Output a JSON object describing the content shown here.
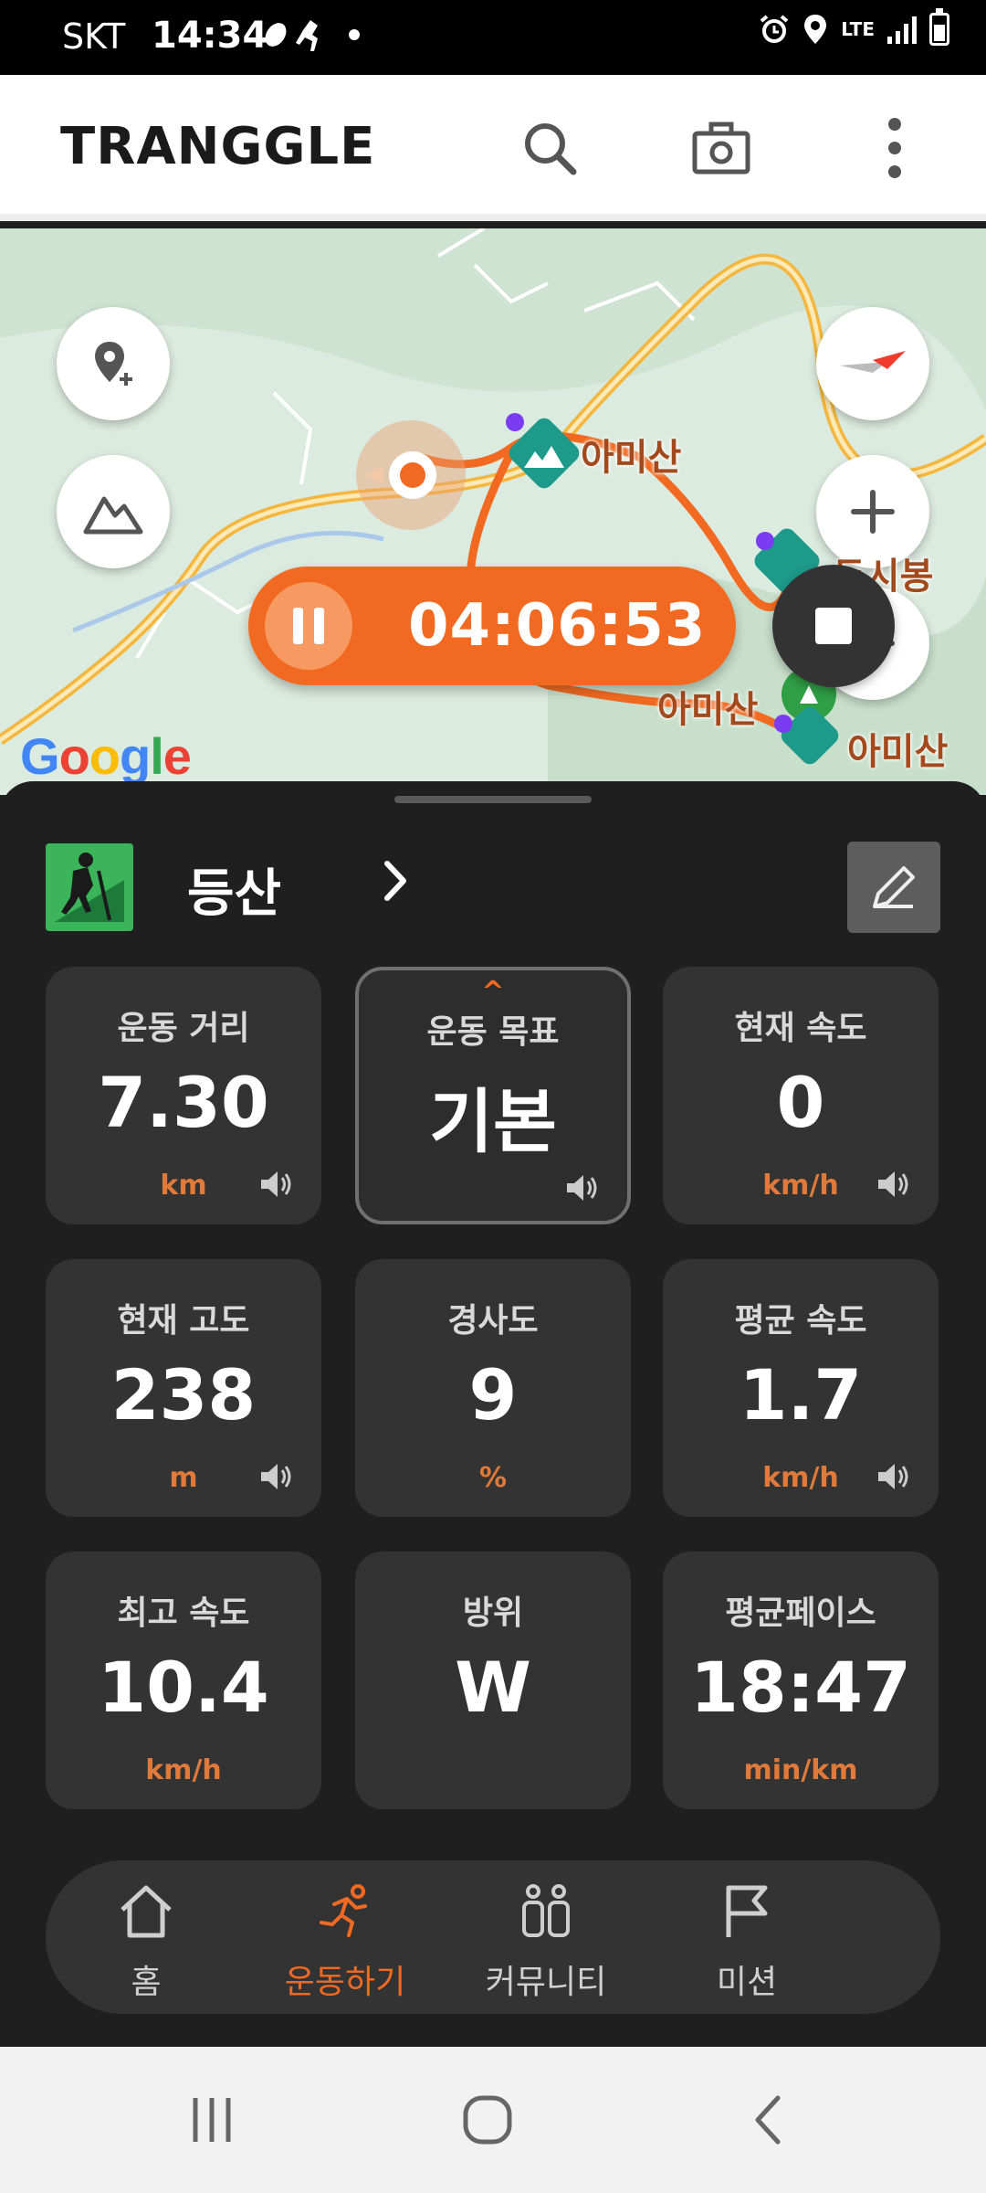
{
  "status_bar": {
    "carrier": "SKT",
    "time": "14:34",
    "network": "LTE"
  },
  "app": {
    "logo": "TRANGGLE",
    "icons": [
      "search-icon",
      "camera-icon",
      "more-vert-icon"
    ]
  },
  "map": {
    "peaks": [
      "아미산",
      "두시봉",
      "아미산",
      "아미산"
    ],
    "google_logo": "Google",
    "controls": [
      "add-location-icon",
      "terrain-icon",
      "compass-icon",
      "zoom-in-icon"
    ]
  },
  "recording": {
    "timer": "04:06:53"
  },
  "activity": {
    "type": "등산"
  },
  "stats": [
    {
      "label": "운동 거리",
      "value": "7.30",
      "unit": "km",
      "sound": true
    },
    {
      "label": "운동 목표",
      "value": "기본",
      "unit": "",
      "sound": true,
      "selected": true
    },
    {
      "label": "현재 속도",
      "value": "0",
      "unit": "km/h",
      "sound": true
    },
    {
      "label": "현재 고도",
      "value": "238",
      "unit": "m",
      "sound": true
    },
    {
      "label": "경사도",
      "value": "9",
      "unit": "%",
      "sound": false
    },
    {
      "label": "평균 속도",
      "value": "1.7",
      "unit": "km/h",
      "sound": true
    },
    {
      "label": "최고 속도",
      "value": "10.4",
      "unit": "km/h",
      "sound": false
    },
    {
      "label": "방위",
      "value": "W",
      "unit": "",
      "sound": false
    },
    {
      "label": "평균페이스",
      "value": "18:47",
      "unit": "min/km",
      "sound": false
    }
  ],
  "bottom_nav": [
    {
      "label": "홈",
      "icon": "home-icon",
      "active": false
    },
    {
      "label": "운동하기",
      "icon": "running-icon",
      "active": true
    },
    {
      "label": "커뮤니티",
      "icon": "community-icon",
      "active": false
    },
    {
      "label": "미션",
      "icon": "flag-icon",
      "active": false
    }
  ],
  "colors": {
    "accent": "#f26a21",
    "sheet": "#1f1f1f",
    "card": "#333333",
    "activity_green": "#3cb55a"
  }
}
